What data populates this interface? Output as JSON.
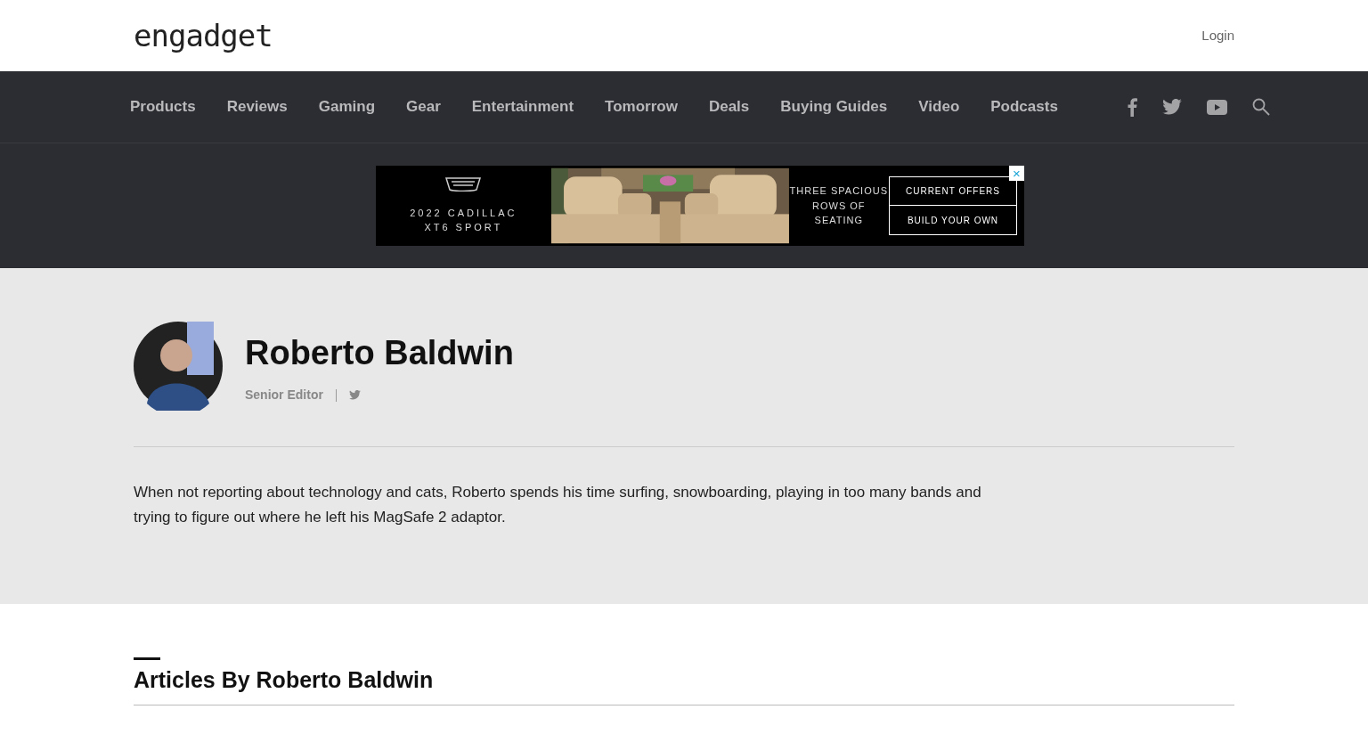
{
  "header": {
    "logo": "engadget",
    "login": "Login"
  },
  "nav": {
    "items": [
      "Products",
      "Reviews",
      "Gaming",
      "Gear",
      "Entertainment",
      "Tomorrow",
      "Deals",
      "Buying Guides",
      "Video",
      "Podcasts"
    ]
  },
  "ad": {
    "model": "2022 CADILLAC XT6 SPORT",
    "tagline": "THREE SPACIOUS ROWS OF SEATING",
    "buttons": [
      "CURRENT OFFERS",
      "BUILD YOUR OWN"
    ],
    "close": "×"
  },
  "author": {
    "name": "Roberto Baldwin",
    "role": "Senior Editor",
    "bio": "When not reporting about technology and cats, Roberto spends his time surfing, snowboarding, playing in too many bands and trying to figure out where he left his MagSafe 2 adaptor."
  },
  "articles": {
    "heading": "Articles By Roberto Baldwin"
  }
}
